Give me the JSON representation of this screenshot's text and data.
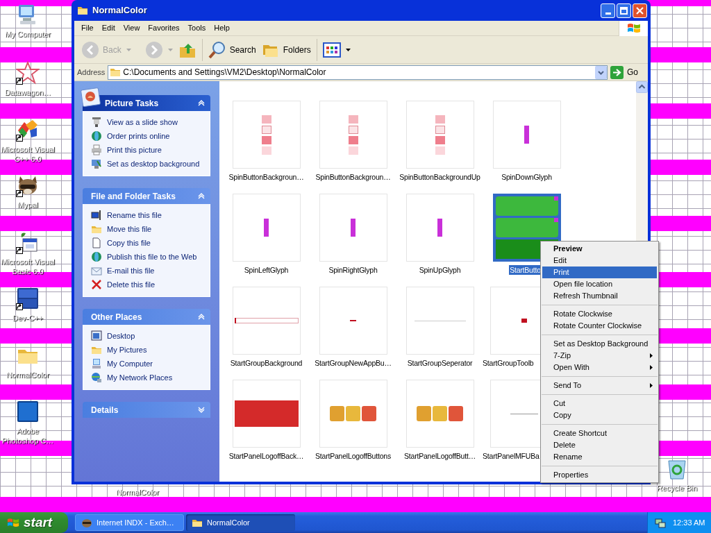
{
  "desktop_icons": [
    {
      "label": "My Computer",
      "kind": "computer",
      "shortcut": false
    },
    {
      "label": "Datawagon…",
      "kind": "star",
      "shortcut": true
    },
    {
      "label": "Microsoft Visual C++ 6.0",
      "kind": "blocks",
      "shortcut": true
    },
    {
      "label": "Mypal",
      "kind": "animal",
      "shortcut": true
    },
    {
      "label": "Microsoft Visual Basic 6.0",
      "kind": "calendar",
      "shortcut": true
    },
    {
      "label": "Dev-C++",
      "kind": "dev",
      "shortcut": true
    },
    {
      "label": "NormalColor",
      "kind": "folder",
      "shortcut": false
    },
    {
      "label": "Adobe Photoshop C…",
      "kind": "ps",
      "shortcut": false
    },
    {
      "label": "NormalColor",
      "kind": "hidden",
      "shortcut": false
    },
    {
      "label": "Recycle Bin",
      "kind": "recycle",
      "shortcut": false
    }
  ],
  "window": {
    "title": "NormalColor",
    "menu": [
      "File",
      "Edit",
      "View",
      "Favorites",
      "Tools",
      "Help"
    ],
    "toolbar": [
      {
        "label": "Back",
        "kind": "back",
        "disabled": true
      },
      {
        "kind": "forward",
        "disabled": true
      },
      {
        "kind": "up",
        "disabled": false
      },
      {
        "label": "Search",
        "kind": "search",
        "disabled": false
      },
      {
        "label": "Folders",
        "kind": "folders",
        "disabled": false
      },
      {
        "kind": "views",
        "disabled": false
      }
    ],
    "address": {
      "label": "Address",
      "value": "C:\\Documents and Settings\\VM2\\Desktop\\NormalColor",
      "go": "Go"
    }
  },
  "sidebar": [
    {
      "title": "Picture Tasks",
      "kind": "special",
      "expanded": true,
      "items": [
        {
          "label": "View as a slide show"
        },
        {
          "label": "Order prints online"
        },
        {
          "label": "Print this picture"
        },
        {
          "label": "Set as desktop background"
        }
      ]
    },
    {
      "title": "File and Folder Tasks",
      "kind": "normal",
      "expanded": true,
      "items": [
        {
          "label": "Rename this file"
        },
        {
          "label": "Move this file"
        },
        {
          "label": "Copy this file"
        },
        {
          "label": "Publish this file to the Web"
        },
        {
          "label": "E-mail this file"
        },
        {
          "label": "Delete this file"
        }
      ]
    },
    {
      "title": "Other Places",
      "kind": "normal",
      "expanded": true,
      "items": [
        {
          "label": "Desktop"
        },
        {
          "label": "My Pictures"
        },
        {
          "label": "My Computer"
        },
        {
          "label": "My Network Places"
        }
      ]
    },
    {
      "title": "Details",
      "kind": "normal",
      "expanded": false
    }
  ],
  "files": [
    {
      "name": "SpinButtonBackgroun…",
      "kind": "spin",
      "selected": false
    },
    {
      "name": "SpinButtonBackgroun…",
      "kind": "spin",
      "selected": false
    },
    {
      "name": "SpinButtonBackgroundUp",
      "kind": "spin",
      "selected": false
    },
    {
      "name": "SpinDownGlyph",
      "kind": "glyph",
      "selected": false
    },
    {
      "name": "SpinLeftGlyph",
      "kind": "glyph",
      "selected": false
    },
    {
      "name": "SpinRightGlyph",
      "kind": "glyph",
      "selected": false
    },
    {
      "name": "SpinUpGlyph",
      "kind": "glyph",
      "selected": false
    },
    {
      "name": "StartButto",
      "kind": "green",
      "selected": true
    },
    {
      "name": "StartGroupBackground",
      "kind": "outline",
      "selected": false
    },
    {
      "name": "StartGroupNewAppBu…",
      "kind": "dash",
      "selected": false
    },
    {
      "name": "StartGroupSeperator",
      "kind": "line",
      "selected": false
    },
    {
      "name": "StartGroupToolb",
      "kind": "dot",
      "selected": false
    },
    {
      "name": "StartPanelLogoffBack…",
      "kind": "redblock",
      "selected": false
    },
    {
      "name": "StartPanelLogoffButtons",
      "kind": "logoff",
      "selected": false
    },
    {
      "name": "StartPanelLogoffButt…",
      "kind": "logoff",
      "selected": false
    },
    {
      "name": "StartPanelMFUBa",
      "kind": "rule",
      "selected": false
    }
  ],
  "context_menu": [
    [
      {
        "label": "Preview",
        "default": true,
        "selected": false,
        "submenu": false
      },
      {
        "label": "Edit",
        "default": false,
        "selected": false,
        "submenu": false
      },
      {
        "label": "Print",
        "default": false,
        "selected": true,
        "submenu": false
      },
      {
        "label": "Open file location",
        "default": false,
        "selected": false,
        "submenu": false
      },
      {
        "label": "Refresh Thumbnail",
        "default": false,
        "selected": false,
        "submenu": false
      }
    ],
    [
      {
        "label": "Rotate Clockwise",
        "default": false,
        "selected": false,
        "submenu": false
      },
      {
        "label": "Rotate Counter Clockwise",
        "default": false,
        "selected": false,
        "submenu": false
      }
    ],
    [
      {
        "label": "Set as Desktop Background",
        "default": false,
        "selected": false,
        "submenu": false
      },
      {
        "label": "7-Zip",
        "default": false,
        "selected": false,
        "submenu": true
      },
      {
        "label": "Open With",
        "default": false,
        "selected": false,
        "submenu": true
      }
    ],
    [
      {
        "label": "Send To",
        "default": false,
        "selected": false,
        "submenu": true
      }
    ],
    [
      {
        "label": "Cut",
        "default": false,
        "selected": false,
        "submenu": false
      },
      {
        "label": "Copy",
        "default": false,
        "selected": false,
        "submenu": false
      }
    ],
    [
      {
        "label": "Create Shortcut",
        "default": false,
        "selected": false,
        "submenu": false
      },
      {
        "label": "Delete",
        "default": false,
        "selected": false,
        "submenu": false
      },
      {
        "label": "Rename",
        "default": false,
        "selected": false,
        "submenu": false
      }
    ],
    [
      {
        "label": "Properties",
        "default": false,
        "selected": false,
        "submenu": false
      }
    ]
  ],
  "taskbar": {
    "start": "start",
    "tasks": [
      {
        "label": "Internet INDX - Exch…",
        "selected": false
      },
      {
        "label": "NormalColor",
        "selected": true
      }
    ],
    "clock": "12:33 AM"
  }
}
